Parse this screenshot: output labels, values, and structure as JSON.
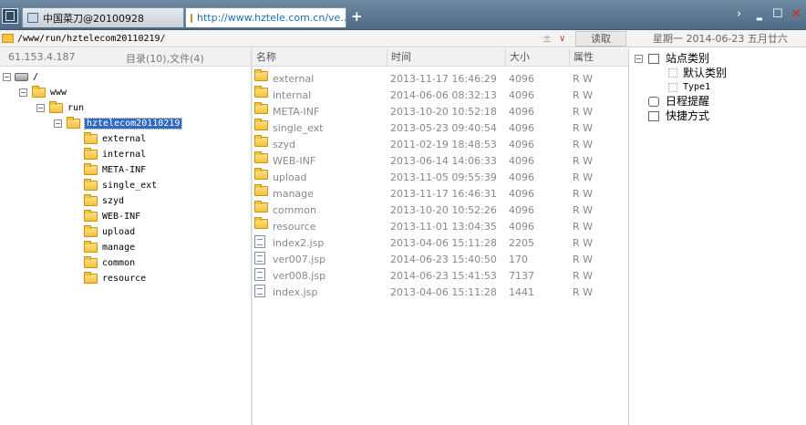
{
  "tabs": [
    {
      "label": "中国菜刀@20100928",
      "icon": "window-icon",
      "active": false
    },
    {
      "label": "http://www.hztele.com.cn/ve...",
      "icon": "folder-icon",
      "active": true
    }
  ],
  "new_tab_symbol": "+",
  "window_controls": {
    "chevron": "›",
    "minimize": "▬",
    "maximize": "☐",
    "close": "✕"
  },
  "address": {
    "path": "/www/run/hztelecom20110219/",
    "plus": "±",
    "dropdown": "∨",
    "read_button": "读取",
    "date_text": "星期一 2014-06-23 五月廿六"
  },
  "left_header": {
    "ip": "61.153.4.187",
    "summary": "目录(10),文件(4)"
  },
  "tree": {
    "root": "/",
    "www": "www",
    "run": "run",
    "selected": "hztelecom20110219",
    "children": [
      "external",
      "internal",
      "META-INF",
      "single_ext",
      "szyd",
      "WEB-INF",
      "upload",
      "manage",
      "common",
      "resource"
    ]
  },
  "list": {
    "columns": {
      "name": "名称",
      "time": "时间",
      "size": "大小",
      "attr": "属性"
    },
    "rows": [
      {
        "name": "external",
        "time": "2013-11-17 16:46:29",
        "size": "4096",
        "attr": "R W",
        "type": "folder"
      },
      {
        "name": "internal",
        "time": "2014-06-06 08:32:13",
        "size": "4096",
        "attr": "R W",
        "type": "folder"
      },
      {
        "name": "META-INF",
        "time": "2013-10-20 10:52:18",
        "size": "4096",
        "attr": "R W",
        "type": "folder"
      },
      {
        "name": "single_ext",
        "time": "2013-05-23 09:40:54",
        "size": "4096",
        "attr": "R W",
        "type": "folder"
      },
      {
        "name": "szyd",
        "time": "2011-02-19 18:48:53",
        "size": "4096",
        "attr": "R W",
        "type": "folder"
      },
      {
        "name": "WEB-INF",
        "time": "2013-06-14 14:06:33",
        "size": "4096",
        "attr": "R W",
        "type": "folder"
      },
      {
        "name": "upload",
        "time": "2013-11-05 09:55:39",
        "size": "4096",
        "attr": "R W",
        "type": "folder"
      },
      {
        "name": "manage",
        "time": "2013-11-17 16:46:31",
        "size": "4096",
        "attr": "R W",
        "type": "folder"
      },
      {
        "name": "common",
        "time": "2013-10-20 10:52:26",
        "size": "4096",
        "attr": "R W",
        "type": "folder"
      },
      {
        "name": "resource",
        "time": "2013-11-01 13:04:35",
        "size": "4096",
        "attr": "R W",
        "type": "folder"
      },
      {
        "name": "index2.jsp",
        "time": "2013-04-06 15:11:28",
        "size": "2205",
        "attr": "R W",
        "type": "file"
      },
      {
        "name": "ver007.jsp",
        "time": "2014-06-23 15:40:50",
        "size": "170",
        "attr": "R W",
        "type": "file"
      },
      {
        "name": "ver008.jsp",
        "time": "2014-06-23 15:41:53",
        "size": "7137",
        "attr": "R W",
        "type": "file"
      },
      {
        "name": "index.jsp",
        "time": "2013-04-06 15:11:28",
        "size": "1441",
        "attr": "R W",
        "type": "file"
      }
    ]
  },
  "right_tree": {
    "site_category": "站点类别",
    "default_category": "默认类别",
    "type1": "Type1",
    "schedule": "日程提醒",
    "shortcut": "快捷方式"
  },
  "colors": {
    "selection": "#316ac5",
    "tab_active_text": "#1a6fb5",
    "close_red": "#e02020"
  }
}
